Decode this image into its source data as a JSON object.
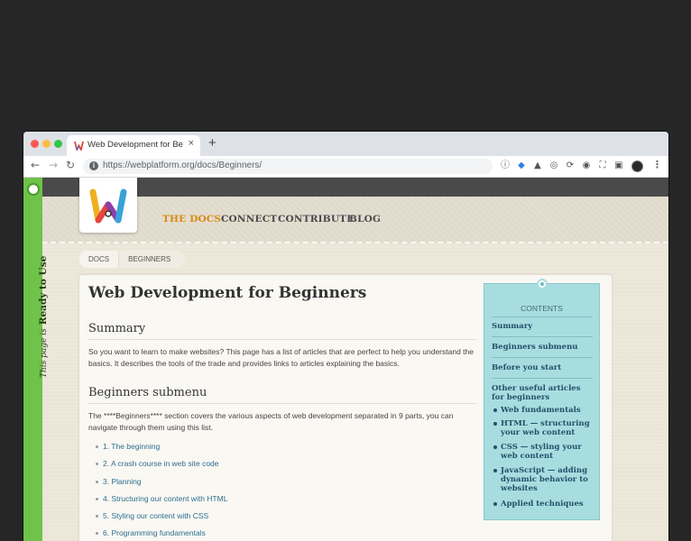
{
  "browser": {
    "tab_title": "Web Development for Beginners",
    "tab_close": "×",
    "new_tab": "+",
    "url_display": "https://webplatform.org/docs/Beginners/",
    "back": "←",
    "forward": "→",
    "reload": "↻",
    "menu": "⋮"
  },
  "flag": {
    "small": "This page is",
    "big": "Ready to Use"
  },
  "nav": {
    "items": [
      {
        "label": "THE DOCS",
        "active": true
      },
      {
        "label": "CONNECT"
      },
      {
        "label": "CONTRIBUTE"
      },
      {
        "label": "BLOG"
      }
    ]
  },
  "breadcrumb": [
    "DOCS",
    "BEGINNERS"
  ],
  "article": {
    "title": "Web Development for Beginners",
    "summary_heading": "Summary",
    "summary_text": "So you want to learn to make websites? This page has a list of articles that are perfect to help you understand the basics. It describes the tools of the trade and provides links to articles explaining the basics.",
    "submenu_heading": "Beginners submenu",
    "submenu_text": "The ****Beginners**** section covers the various aspects of web development separated in 9 parts, you can navigate through them using this list.",
    "list": [
      "1. The beginning",
      "2. A crash course in web site code",
      "3. Planning",
      "4. Structuring our content with HTML",
      "5. Styling our content with CSS",
      "6. Programming fundamentals"
    ]
  },
  "toc": {
    "title": "CONTENTS",
    "links": [
      "Summary",
      "Beginners submenu",
      "Before you start",
      "Other useful articles for beginners"
    ],
    "sub": [
      "Web fundamentals",
      "HTML — structuring your web content",
      "CSS — styling your web content",
      "JavaScript — adding dynamic behavior to websites",
      "Applied techniques"
    ]
  },
  "colors": {
    "accent": "#d98a0b",
    "flag_green": "#6fc24a",
    "toc_bg": "#a8dde0",
    "link": "#2e6e8f"
  }
}
